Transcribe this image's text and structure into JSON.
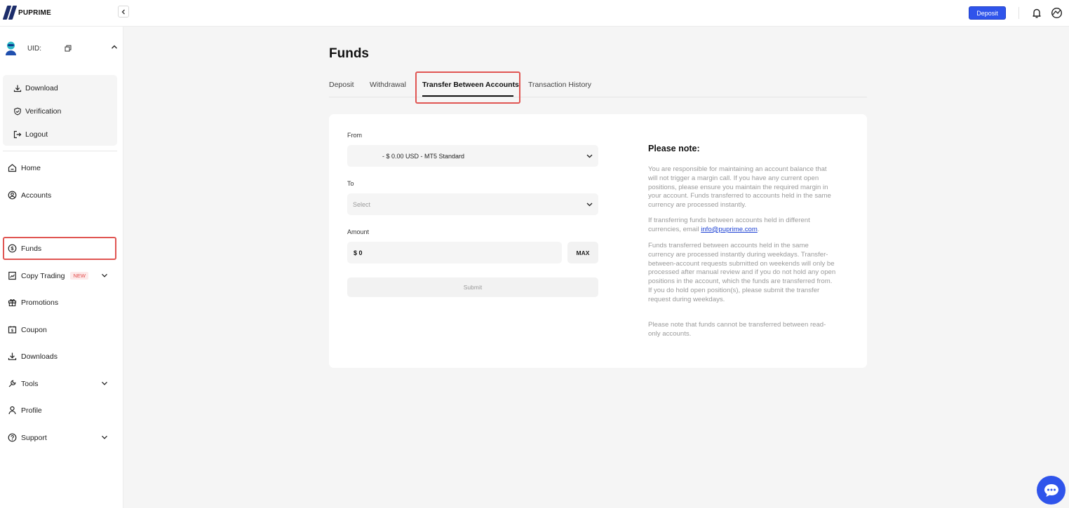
{
  "header": {
    "logo_text": "PUPRIME",
    "deposit_label": "Deposit"
  },
  "sidebar": {
    "uid_label": "UID:",
    "user_menu": [
      {
        "label": "Download",
        "icon": "download-icon"
      },
      {
        "label": "Verification",
        "icon": "shield-check-icon"
      },
      {
        "label": "Logout",
        "icon": "logout-icon"
      }
    ],
    "nav": [
      {
        "label": "Home",
        "icon": "home-icon"
      },
      {
        "label": "Accounts",
        "icon": "accounts-icon"
      },
      {
        "label": "Funds",
        "icon": "funds-icon",
        "active": true
      },
      {
        "label": "Copy Trading",
        "icon": "copy-trading-icon",
        "badge": "NEW"
      },
      {
        "label": "Promotions",
        "icon": "gift-icon"
      },
      {
        "label": "Coupon",
        "icon": "coupon-icon"
      },
      {
        "label": "Downloads",
        "icon": "download-icon"
      },
      {
        "label": "Tools",
        "icon": "tools-icon"
      },
      {
        "label": "Profile",
        "icon": "profile-icon"
      },
      {
        "label": "Support",
        "icon": "support-icon"
      }
    ]
  },
  "main": {
    "title": "Funds",
    "tabs": [
      {
        "label": "Deposit"
      },
      {
        "label": "Withdrawal"
      },
      {
        "label": "Transfer Between Accounts",
        "active": true
      },
      {
        "label": "Transaction History"
      }
    ]
  },
  "form": {
    "from_label": "From",
    "from_value": "- $ 0.00 USD - MT5 Standard",
    "to_label": "To",
    "to_placeholder": "Select",
    "amount_label": "Amount",
    "amount_value": "$ 0",
    "max_label": "MAX",
    "submit_label": "Submit"
  },
  "note": {
    "title": "Please note:",
    "p1": "You are responsible for maintaining an account balance that will not trigger a margin call. If you have any current open positions, please ensure you maintain the required margin in your account. Funds transferred to accounts held in the same currency are processed instantly.",
    "p2_prefix": "If transferring funds between accounts held in different currencies, email ",
    "p2_link": "info@puprime.com",
    "p2_suffix": ".",
    "p3": "Funds transferred between accounts held in the same currency are processed instantly during weekdays. Transfer-between-account requests submitted on weekends will only be processed after manual review and if you do not hold any open positions in the account, which the funds are transferred from. If you do hold open position(s), please submit the transfer request during weekdays.",
    "p4": "Please note that funds cannot be transferred between read-only accounts."
  },
  "colors": {
    "accent": "#2f54eb",
    "highlight": "#e05552",
    "new_badge": "#e24c4b"
  }
}
